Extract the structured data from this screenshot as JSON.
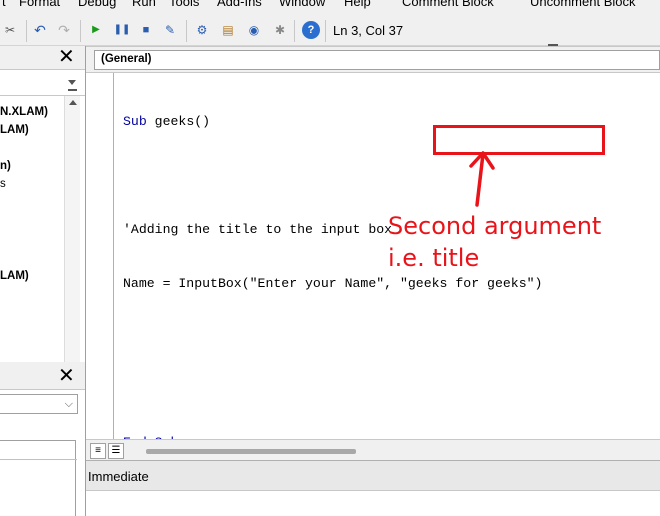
{
  "menubar": {
    "items": [
      "t",
      "Format",
      "Debug",
      "Run",
      "Tools",
      "Add-Ins",
      "Window",
      "Help",
      "Comment Block",
      "Uncomment Block"
    ]
  },
  "toolbar": {
    "cursor_position": "Ln 3, Col 37",
    "icons": [
      "undo-icon",
      "redo-icon",
      "run-icon",
      "break-icon",
      "reset-icon",
      "design-mode-icon",
      "project-explorer-icon",
      "properties-icon",
      "object-browser-icon",
      "toolbox-icon",
      "help-icon"
    ]
  },
  "project_pane": {
    "items": [
      "N.XLAM)",
      "LAM)",
      "n)",
      "s",
      "LAM)"
    ]
  },
  "code_window": {
    "object_combo": "(General)",
    "lines": [
      {
        "kw": "Sub",
        "rest": " geeks()"
      },
      {
        "kw": "",
        "rest": ""
      },
      {
        "kw": "",
        "rest": "'Adding the title to the input box"
      },
      {
        "kw": "",
        "rest": "Name = InputBox(\"Enter your Name\", \"geeks for geeks\")"
      },
      {
        "kw": "",
        "rest": ""
      },
      {
        "kw": "",
        "rest": ""
      },
      {
        "kw": "End Sub",
        "rest": ""
      }
    ]
  },
  "immediate": {
    "title": "Immediate"
  },
  "annotation": {
    "line1": "Second argument",
    "line2": "i.e. title",
    "color": "#e8141a"
  },
  "colors": {
    "keyword": "#0000a0",
    "annotation": "#e8141a"
  }
}
